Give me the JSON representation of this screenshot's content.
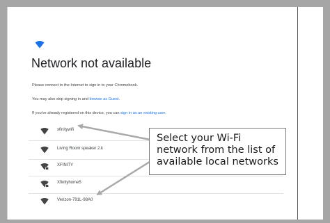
{
  "page": {
    "title": "Network not available",
    "line1": "Please connect to the Internet to sign in to your Chromebook.",
    "line2_prefix": "You may also skip signing in and ",
    "line2_link": "browse as Guest",
    "line2_suffix": ".",
    "line3_prefix": "If you've already registered on this device, you can ",
    "line3_link": "sign in as an existing user",
    "line3_suffix": "."
  },
  "networks": [
    {
      "label": "xfinitywifi",
      "icon": "wifi-icon"
    },
    {
      "label": "Living Room speaker 2.k",
      "icon": "wifi-icon"
    },
    {
      "label": "XFINITY",
      "icon": "wifi-lock-icon"
    },
    {
      "label": "Xfinityhome5",
      "icon": "wifi-lock-icon"
    },
    {
      "label": "Verizon-791L-98A0",
      "icon": "wifi-icon"
    }
  ],
  "callout": {
    "text": "Select your Wi-Fi network from the list of available local networks"
  },
  "colors": {
    "brand_blue": "#1a73e8",
    "frame_gray": "#a6a6a6",
    "text_dark": "#202124"
  }
}
